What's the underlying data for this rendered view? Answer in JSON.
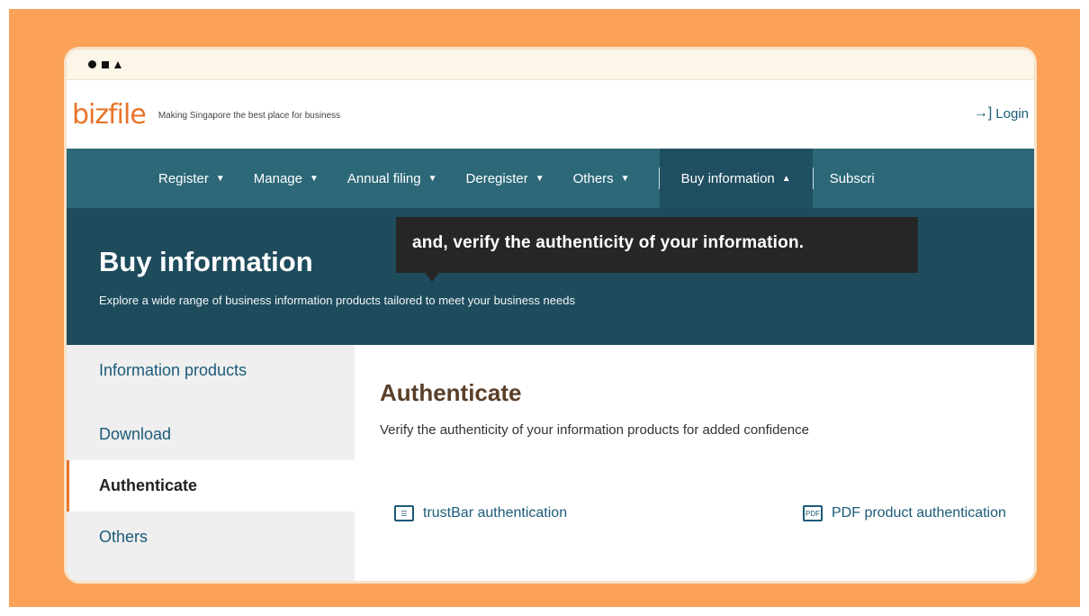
{
  "header": {
    "logo": "bizfile",
    "tagline": "Making Singapore the best place for business",
    "login_icon": "login-icon",
    "login": "Login"
  },
  "nav": {
    "items": [
      {
        "label": "Register"
      },
      {
        "label": "Manage"
      },
      {
        "label": "Annual filing"
      },
      {
        "label": "Deregister"
      },
      {
        "label": "Others"
      }
    ],
    "active": {
      "label": "Buy information"
    },
    "subscribe": "Subscri"
  },
  "hero": {
    "title": "Buy information",
    "subtitle": "Explore a wide range of business information products tailored to meet your business needs"
  },
  "caption": "and, verify the authenticity of your information.",
  "sidebar": {
    "items": [
      {
        "label": "Information products"
      },
      {
        "label": "Download"
      },
      {
        "label": "Authenticate"
      },
      {
        "label": "Others"
      }
    ],
    "active_index": 2
  },
  "main": {
    "title": "Authenticate",
    "subtitle": "Verify the authenticity of your information products for added confidence",
    "links": [
      {
        "icon": "checklist-icon",
        "label": "trustBar authentication"
      },
      {
        "icon": "pdf-icon",
        "label": "PDF product authentication"
      }
    ]
  },
  "colors": {
    "background": "#FCA158",
    "nav": "#2C6878",
    "hero": "#1F4C5D",
    "accent": "#E8742A"
  }
}
